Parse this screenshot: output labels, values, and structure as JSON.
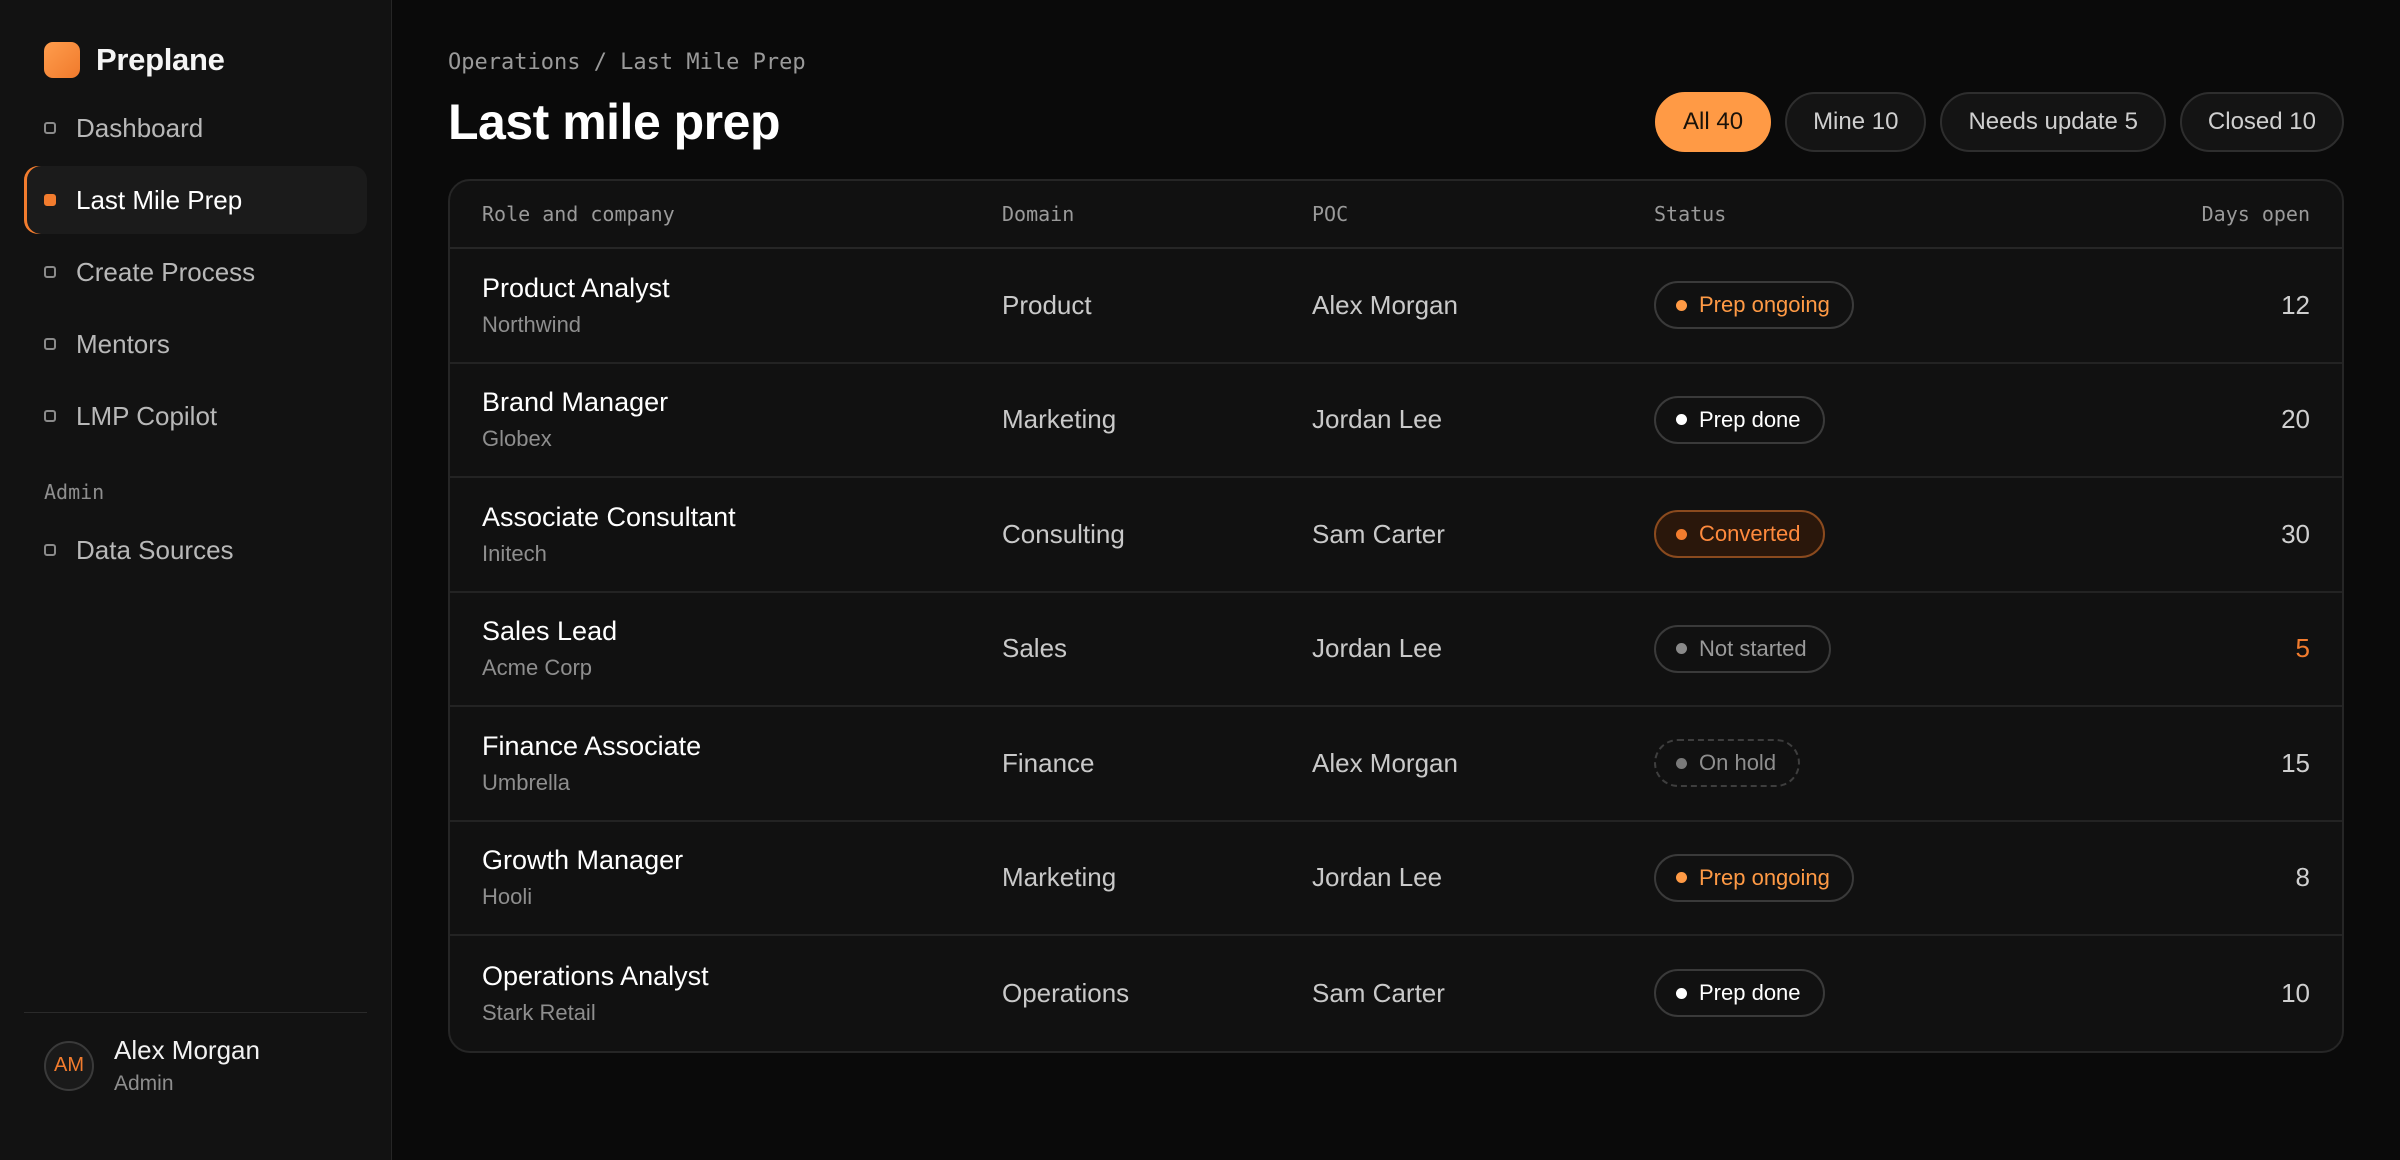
{
  "app": {
    "name": "Preplane"
  },
  "sidebar": {
    "items": [
      {
        "label": "Dashboard",
        "active": false
      },
      {
        "label": "Last Mile Prep",
        "active": true
      },
      {
        "label": "Create Process",
        "active": false
      },
      {
        "label": "Mentors",
        "active": false
      },
      {
        "label": "LMP Copilot",
        "active": false
      }
    ],
    "admin_label": "Admin",
    "admin_items": [
      {
        "label": "Data Sources"
      }
    ],
    "user": {
      "initials": "AM",
      "name": "Alex Morgan",
      "role": "Admin"
    }
  },
  "header": {
    "breadcrumb": "Operations / Last Mile Prep",
    "title": "Last mile prep"
  },
  "filters": [
    {
      "label": "All 40",
      "active": true
    },
    {
      "label": "Mine 10",
      "active": false
    },
    {
      "label": "Needs update 5",
      "active": false
    },
    {
      "label": "Closed 10",
      "active": false
    }
  ],
  "table": {
    "columns": [
      "Role and company",
      "Domain",
      "POC",
      "Status",
      "Days open"
    ],
    "rows": [
      {
        "role": "Product Analyst",
        "company": "Northwind",
        "domain": "Product",
        "poc": "Alex Morgan",
        "status": "Prep ongoing",
        "days": "12"
      },
      {
        "role": "Brand Manager",
        "company": "Globex",
        "domain": "Marketing",
        "poc": "Jordan Lee",
        "status": "Prep done",
        "days": "20"
      },
      {
        "role": "Associate Consultant",
        "company": "Initech",
        "domain": "Consulting",
        "poc": "Sam Carter",
        "status": "Converted",
        "days": "30"
      },
      {
        "role": "Sales Lead",
        "company": "Acme Corp",
        "domain": "Sales",
        "poc": "Jordan Lee",
        "status": "Not started",
        "days": "5"
      },
      {
        "role": "Finance Associate",
        "company": "Umbrella",
        "domain": "Finance",
        "poc": "Alex Morgan",
        "status": "On hold",
        "days": "15"
      },
      {
        "role": "Growth Manager",
        "company": "Hooli",
        "domain": "Marketing",
        "poc": "Jordan Lee",
        "status": "Prep ongoing",
        "days": "8"
      },
      {
        "role": "Operations Analyst",
        "company": "Stark Retail",
        "domain": "Operations",
        "poc": "Sam Carter",
        "status": "Prep done",
        "days": "10"
      }
    ]
  },
  "colors": {
    "accent": "#f27c2e",
    "accent_light": "#ff9a45",
    "background": "#0a0a0a"
  }
}
